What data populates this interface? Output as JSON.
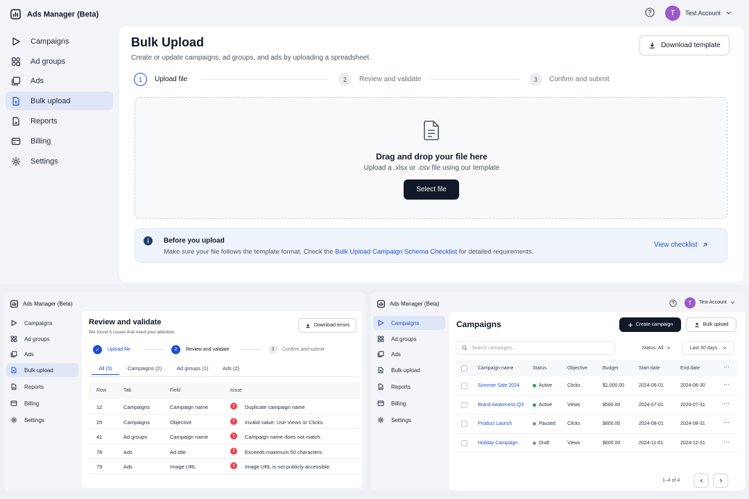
{
  "top": {
    "app_title": "Ads Manager (Beta)",
    "nav": [
      {
        "label": "Campaigns",
        "icon": "play-triangle-icon"
      },
      {
        "label": "Ad groups",
        "icon": "ad-groups-icon"
      },
      {
        "label": "Ads",
        "icon": "ads-stack-icon"
      },
      {
        "label": "Bulk upload",
        "icon": "file-upload-icon"
      },
      {
        "label": "Reports",
        "icon": "reports-icon"
      },
      {
        "label": "Billing",
        "icon": "billing-card-icon"
      },
      {
        "label": "Settings",
        "icon": "gear-icon"
      }
    ],
    "account": {
      "initial": "T",
      "name": "Test Account"
    },
    "page_title": "Bulk Upload",
    "page_subtitle": "Create or update campaigns, ad groups, and ads by uploading a spreadsheet.",
    "download_template_label": "Download template",
    "steps": [
      {
        "num": "1",
        "label": "Upload file"
      },
      {
        "num": "2",
        "label": "Review and validate"
      },
      {
        "num": "3",
        "label": "Confirm and submit"
      }
    ],
    "dropzone": {
      "title": "Drag and drop your file here",
      "hint": "Upload a .xlsx or .csv file using our template",
      "button": "Select file"
    },
    "info": {
      "title": "Before you upload",
      "text_before": "Make sure your file follows the template format. Check the",
      "link": "Bulk Upload Campaign Schema Checklist",
      "text_after": "for detailed requirements.",
      "action": "View checklist"
    }
  },
  "review": {
    "app_title": "Ads Manager (Beta)",
    "nav": [
      "Campaigns",
      "Ad groups",
      "Ads",
      "Bulk upload",
      "Reports",
      "Billing",
      "Settings"
    ],
    "title": "Review and validate",
    "subtitle": "We found 5 issues that need your attention.",
    "download_errors_label": "Download errors",
    "steps": [
      {
        "num": "✓",
        "label": "Upload file"
      },
      {
        "num": "2",
        "label": "Review and validate"
      },
      {
        "num": "3",
        "label": "Confirm and submit"
      }
    ],
    "tabs": [
      "All (5)",
      "Campaigns (2)",
      "Ad groups (1)",
      "Ads (2)"
    ],
    "columns": [
      "Row",
      "Tab",
      "Field",
      "Issue"
    ],
    "rows": [
      {
        "row": "12",
        "tab": "Campaigns",
        "field": "Campaign name",
        "issue": "Duplicate campaign name"
      },
      {
        "row": "25",
        "tab": "Campaigns",
        "field": "Objective",
        "issue": "Invalid value. Use Views or Clicks."
      },
      {
        "row": "41",
        "tab": "Ad groups",
        "field": "Campaign name",
        "issue": "Campaign name does not match."
      },
      {
        "row": "78",
        "tab": "Ads",
        "field": "Ad title",
        "issue": "Exceeds maximum 50 characters."
      },
      {
        "row": "79",
        "tab": "Ads",
        "field": "Image URL",
        "issue": "Image URL is not publicly accessible."
      }
    ]
  },
  "campaigns": {
    "app_title": "Ads Manager (Beta)",
    "account": {
      "initial": "T",
      "name": "Test Account"
    },
    "nav": [
      "Campaigns",
      "Ad groups",
      "Ads",
      "Bulk upload",
      "Reports",
      "Billing",
      "Settings"
    ],
    "title": "Campaigns",
    "create_label": "Create campaign",
    "bulk_upload_label": "Bulk upload",
    "search_placeholder": "Search campaigns...",
    "status_filter": "Status: All",
    "date_filter": "Last 30 days",
    "columns": [
      "Campaign name",
      "Status",
      "Objective",
      "Budget",
      "Start date",
      "End date"
    ],
    "rows": [
      {
        "name": "Summer Sale 2024",
        "status": "Active",
        "status_color": "#22a55a",
        "objective": "Clicks",
        "budget": "$1,000.00",
        "start": "2024-06-01",
        "end": "2024-06-30"
      },
      {
        "name": "Brand Awareness Q3",
        "status": "Active",
        "status_color": "#22a55a",
        "objective": "Views",
        "budget": "$500.00",
        "start": "2024-07-01",
        "end": "2024-07-31"
      },
      {
        "name": "Product Launch",
        "status": "Paused",
        "status_color": "#8b8f97",
        "objective": "Clicks",
        "budget": "$800.00",
        "start": "2024-08-01",
        "end": "2024-08-31"
      },
      {
        "name": "Holiday Campaign",
        "status": "Draft",
        "status_color": "#8b8f97",
        "objective": "Views",
        "budget": "$600.00",
        "start": "2024-11-01",
        "end": "2024-12-31"
      }
    ],
    "pagination": "1–4 of 4"
  },
  "colors": {
    "accent": "#1d4fd8",
    "dark": "#111827",
    "avatar": "#9b59c9",
    "error": "#e5484d"
  }
}
